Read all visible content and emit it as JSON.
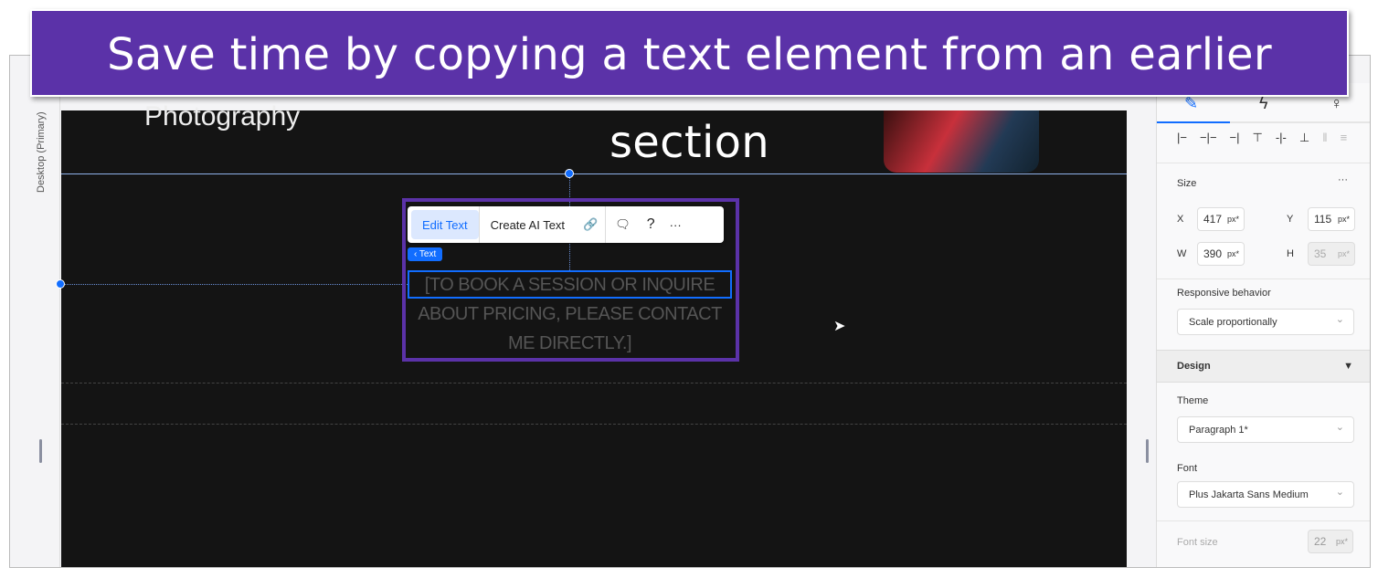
{
  "banner": {
    "text": "Save time by copying a text element from an earlier section"
  },
  "rail": {
    "label": "Desktop (Primary)"
  },
  "canvas": {
    "header_title": "Photography",
    "tag": "‹ Text",
    "paragraph": "[TO BOOK A SESSION OR INQUIRE ABOUT PRICING, PLEASE CONTACT ME DIRECTLY.]"
  },
  "toolbar": {
    "edit_text": "Edit Text",
    "create_ai_text": "Create AI Text",
    "link": "🔗",
    "comment": "🗨",
    "help": "?",
    "more": "···"
  },
  "panel": {
    "tabs": [
      "✎",
      "ϟ",
      "♀"
    ],
    "align_icons": [
      "|−",
      "−|−",
      "−|",
      "⊤",
      "-|-",
      "⊥",
      "‖",
      "≡"
    ],
    "size_label": "Size",
    "more": "···",
    "x_label": "X",
    "x": "417",
    "y_label": "Y",
    "y": "115",
    "w_label": "W",
    "w": "390",
    "h_label": "H",
    "h": "35",
    "unit": "px*",
    "responsive_label": "Responsive behavior",
    "responsive_value": "Scale proportionally",
    "design_label": "Design",
    "design_arrow": "▼",
    "theme_label": "Theme",
    "theme_value": "Paragraph 1*",
    "font_label": "Font",
    "font_value": "Plus Jakarta Sans Medium",
    "font_size_label": "Font size",
    "font_size": "22"
  },
  "colors": {
    "accent": "#116dff",
    "highlight": "#5b32a8",
    "canvas": "#141414"
  }
}
